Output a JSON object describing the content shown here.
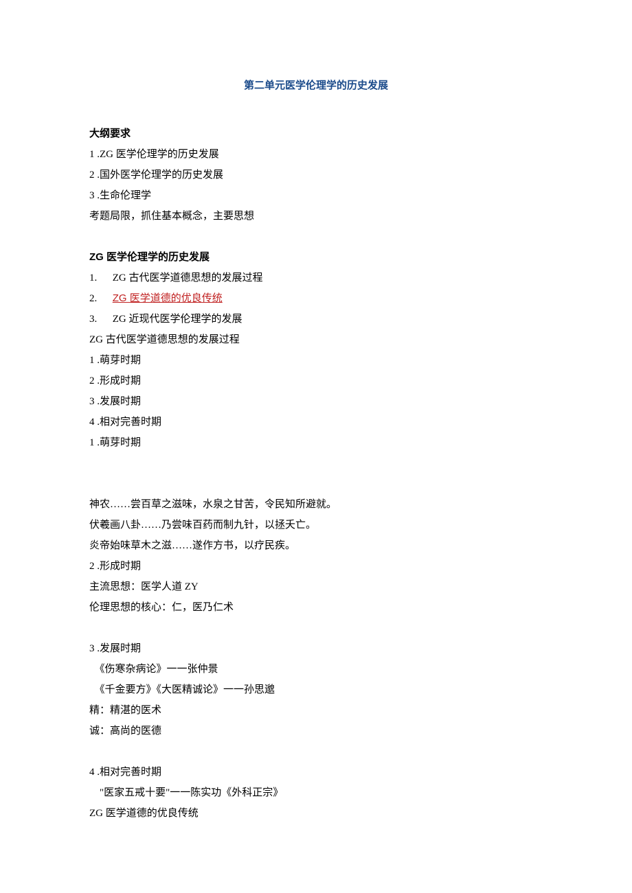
{
  "title": "第二单元医学伦理学的历史发展",
  "section1": {
    "heading": "大纲要求",
    "items": [
      "1 .ZG 医学伦理学的历史发展",
      "2 .国外医学伦理学的历史发展",
      "3 .生命伦理学"
    ],
    "note": "考题局限，抓住基本概念，主要思想"
  },
  "section2": {
    "heading": "ZG 医学伦理学的历史发展",
    "list_prefix": [
      "1.",
      "2.",
      "3."
    ],
    "list_labels": [
      "ZG 古代医学道德思想的发展过程",
      "ZG 医学道德的优良传统",
      "ZG 近现代医学伦理学的发展"
    ],
    "sub_heading": "ZG 古代医学道德思想的发展过程",
    "periods": [
      "1 .萌芽时期",
      "2 .形成时期",
      "3 .发展时期",
      "4 .相对完善时期",
      "1 .萌芽时期"
    ]
  },
  "body1": [
    "神农……尝百草之滋味，水泉之甘苦，令民知所避就。",
    "伏羲画八卦……乃尝味百药而制九针，以拯夭亡。",
    "炎帝始味草木之滋……遂作方书，以疗民疾。"
  ],
  "forming": {
    "title": "2 .形成时期",
    "lines": [
      "主流思想：医学人道 ZY",
      "伦理思想的核心：仁，医乃仁术"
    ]
  },
  "develop": {
    "title": "3 .发展时期",
    "lines": [
      "　《伤寒杂病论》一一张仲景",
      "　《千金要方》《大医精诚论》一一孙思邈",
      "精：精湛的医术",
      "诚：高尚的医德"
    ]
  },
  "perfect": {
    "title": "4 .相对完善时期",
    "lines": [
      "　\"医家五戒十要\"一一陈实功《外科正宗》",
      "ZG 医学道德的优良传统"
    ]
  }
}
